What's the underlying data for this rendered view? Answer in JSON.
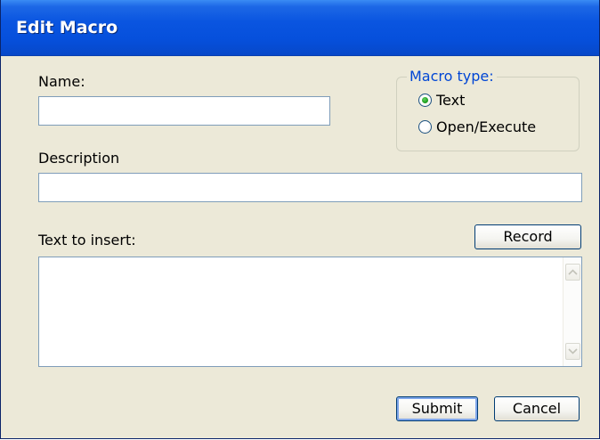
{
  "window": {
    "title": "Edit Macro"
  },
  "form": {
    "name_label": "Name:",
    "name_value": "",
    "description_label": "Description",
    "description_value": "",
    "text_label": "Text to insert:",
    "text_value": ""
  },
  "macro_type": {
    "legend": "Macro type:",
    "options": [
      {
        "label": "Text",
        "selected": true
      },
      {
        "label": "Open/Execute",
        "selected": false
      }
    ]
  },
  "buttons": {
    "record": "Record",
    "submit": "Submit",
    "cancel": "Cancel"
  },
  "icons": {
    "scroll_up": "scroll-up-arrow-icon",
    "scroll_down": "scroll-down-arrow-icon",
    "radio_selected": "radio-selected-icon",
    "radio_unselected": "radio-unselected-icon"
  },
  "colors": {
    "title_bar": "#0650dc",
    "dialog_background": "#ece9d8",
    "legend_text": "#0046d5",
    "input_border": "#7f9db9",
    "button_border": "#003c74",
    "radio_dot": "#21a121"
  }
}
